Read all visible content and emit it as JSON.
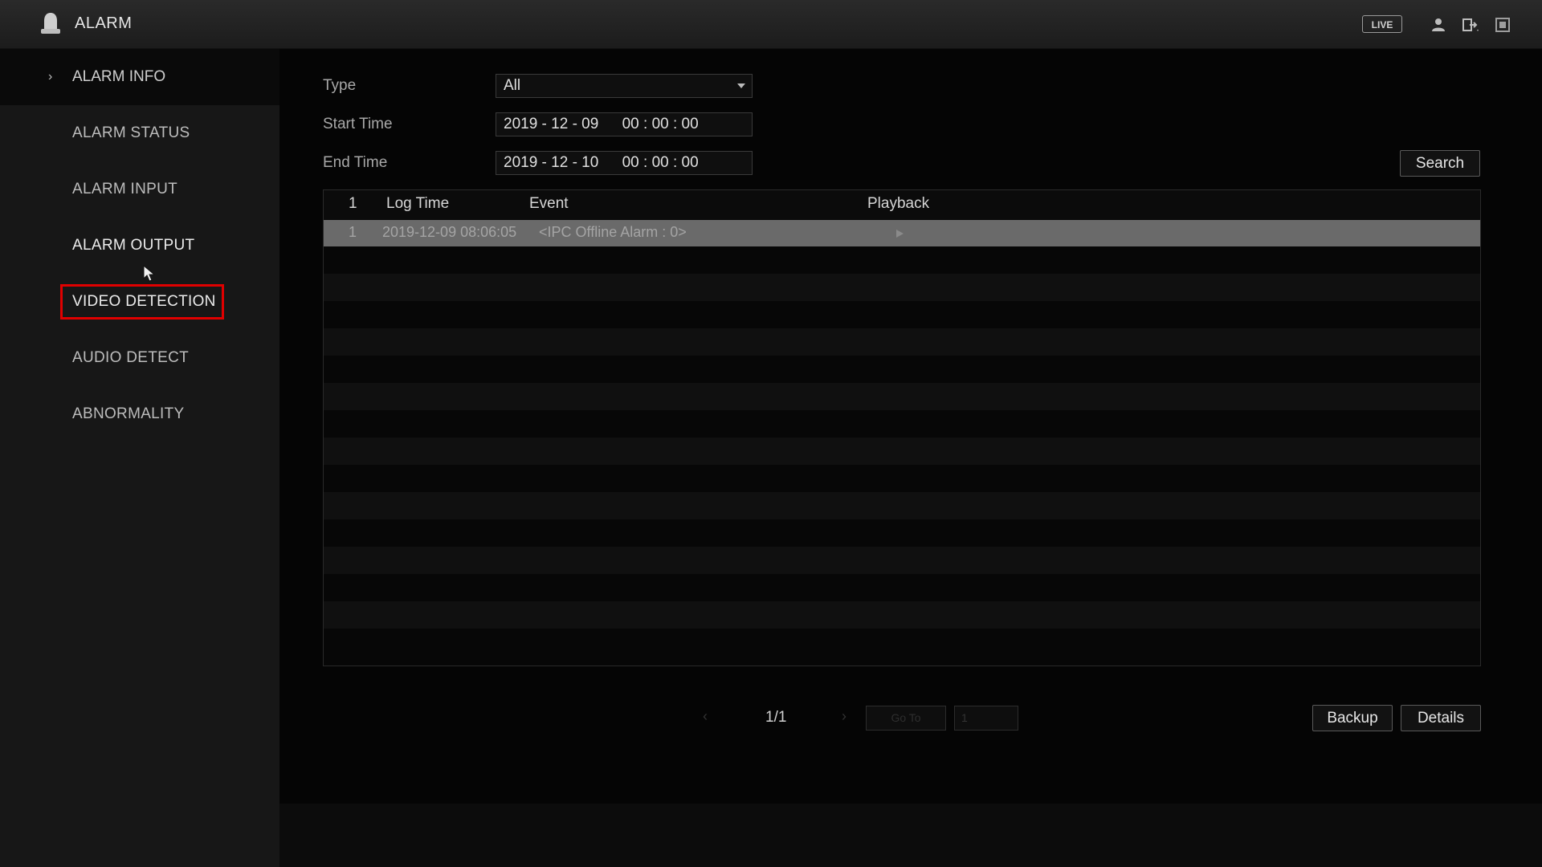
{
  "header": {
    "title": "ALARM",
    "live_label": "LIVE",
    "icons": [
      "alarm-bell-icon",
      "user-icon",
      "logout-icon",
      "layout-icon"
    ]
  },
  "sidebar": {
    "section_label": "ALARM INFO",
    "items": [
      {
        "label": "ALARM STATUS"
      },
      {
        "label": "ALARM INPUT"
      },
      {
        "label": "ALARM OUTPUT"
      },
      {
        "label": "VIDEO DETECTION"
      },
      {
        "label": "AUDIO DETECT"
      },
      {
        "label": "ABNORMALITY"
      }
    ],
    "highlighted_item": "VIDEO DETECTION"
  },
  "filters": {
    "type_label": "Type",
    "type_value": "All",
    "start_label": "Start Time",
    "start_date": "2019 - 12 - 09",
    "start_time": "00 : 00 : 00",
    "end_label": "End Time",
    "end_date": "2019 - 12 - 10",
    "end_time": "00 : 00 : 00",
    "search_label": "Search"
  },
  "table": {
    "headers": {
      "index": "1",
      "log_time": "Log Time",
      "event": "Event",
      "playback": "Playback"
    },
    "rows": [
      {
        "index": "1",
        "log_time": "2019-12-09 08:06:05",
        "event": "<IPC Offline Alarm : 0>"
      }
    ]
  },
  "pagination": {
    "page_indicator": "1/1",
    "prev": "‹",
    "next": "›",
    "goto_label": "Go To",
    "goto_value": "1"
  },
  "actions": {
    "backup_label": "Backup",
    "details_label": "Details"
  },
  "colors": {
    "highlight": "#e00000",
    "background": "#000000",
    "selected_row": "#6a6a6a"
  }
}
